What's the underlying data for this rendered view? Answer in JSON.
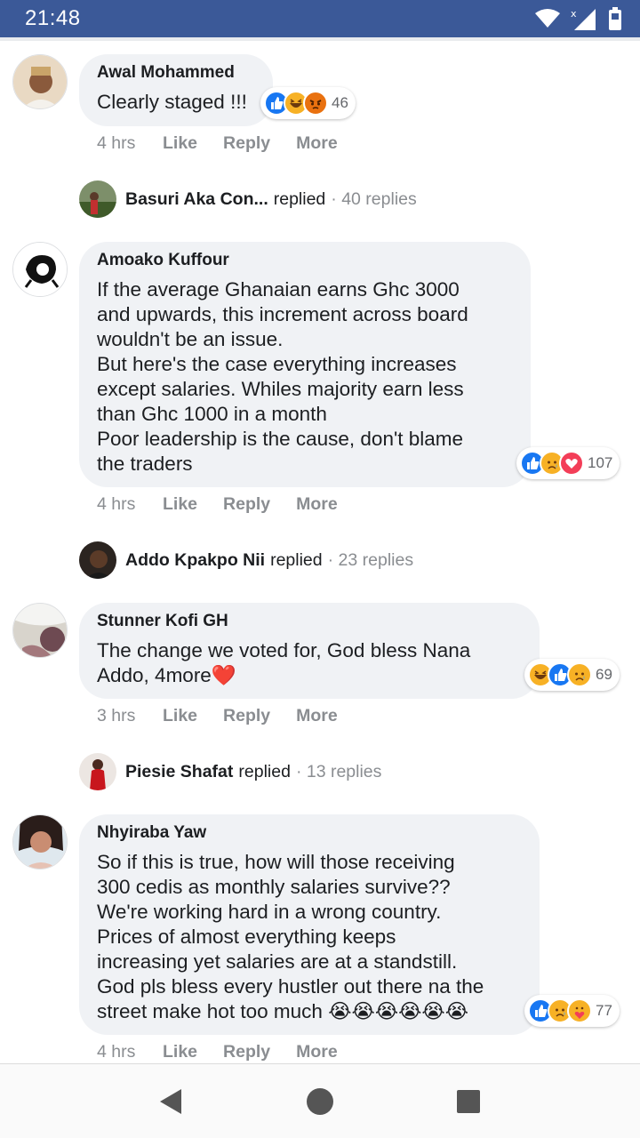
{
  "status_bar": {
    "time": "21:48",
    "bg_color": "#3b5998"
  },
  "comments": [
    {
      "author": "Awal Mohammed",
      "text": "Clearly staged !!!",
      "reaction_count": "46",
      "time": "4 hrs",
      "actions": [
        "Like",
        "Reply",
        "More"
      ],
      "replies": {
        "name": "Basuri Aka Con...",
        "verb": "replied",
        "count": "· 40 replies"
      }
    },
    {
      "author": "Amoako Kuffour",
      "text": "If the average Ghanaian earns Ghc 3000\nand upwards, this increment across board\nwouldn't be an issue.\nBut here's the case everything increases\nexcept salaries. Whiles majority earn less\nthan Ghc 1000 in a month\nPoor leadership is the cause, don't blame\nthe traders",
      "reaction_count": "107",
      "time": "4 hrs",
      "actions": [
        "Like",
        "Reply",
        "More"
      ],
      "replies": {
        "name": "Addo Kpakpo Nii",
        "verb": "replied",
        "count": "· 23 replies"
      }
    },
    {
      "author": "Stunner Kofi GH",
      "text": "The change we voted for, God bless Nana\nAddo, 4more❤️",
      "reaction_count": "69",
      "time": "3 hrs",
      "actions": [
        "Like",
        "Reply",
        "More"
      ],
      "replies": {
        "name": "Piesie Shafat",
        "verb": "replied",
        "count": "· 13 replies"
      }
    },
    {
      "author": "Nhyiraba Yaw",
      "text": "So if this is true, how will those receiving\n300 cedis as monthly salaries survive??\nWe're working hard in a wrong country.\nPrices of almost everything keeps\nincreasing yet salaries are at a standstill.\nGod pls bless every hustler out there na the\nstreet make hot too much 😭😭😭😭😭😭",
      "reaction_count": "77",
      "time": "4 hrs",
      "actions": [
        "Like",
        "Reply",
        "More"
      ]
    }
  ],
  "colors": {
    "like": "#1877f2",
    "love": "#f33e58",
    "haha": "#f7b125",
    "angry": "#e9710f"
  }
}
